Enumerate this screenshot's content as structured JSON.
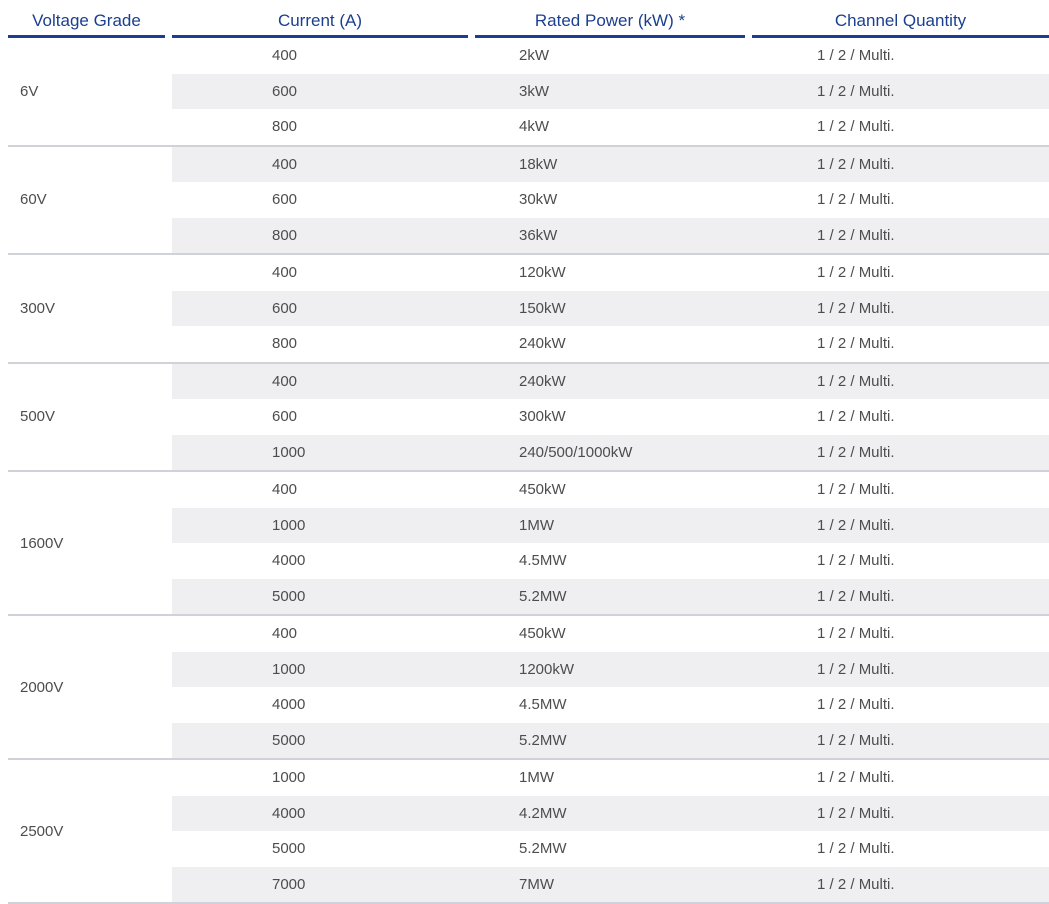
{
  "headers": [
    "Voltage Grade",
    "Current (A)",
    "Rated Power (kW) *",
    "Channel Quantity"
  ],
  "groups": [
    {
      "voltage": "6V",
      "rows": [
        {
          "current": "400",
          "power": "2kW",
          "channels": "1 / 2 / Multi."
        },
        {
          "current": "600",
          "power": "3kW",
          "channels": "1 / 2 / Multi."
        },
        {
          "current": "800",
          "power": "4kW",
          "channels": "1 / 2 / Multi."
        }
      ]
    },
    {
      "voltage": "60V",
      "rows": [
        {
          "current": "400",
          "power": "18kW",
          "channels": "1 / 2 / Multi."
        },
        {
          "current": "600",
          "power": "30kW",
          "channels": "1 / 2 / Multi."
        },
        {
          "current": "800",
          "power": "36kW",
          "channels": "1 / 2 / Multi."
        }
      ]
    },
    {
      "voltage": "300V",
      "rows": [
        {
          "current": "400",
          "power": "120kW",
          "channels": "1 / 2 / Multi."
        },
        {
          "current": "600",
          "power": "150kW",
          "channels": "1 / 2 / Multi."
        },
        {
          "current": "800",
          "power": "240kW",
          "channels": "1 / 2 / Multi."
        }
      ]
    },
    {
      "voltage": "500V",
      "rows": [
        {
          "current": "400",
          "power": "240kW",
          "channels": "1 / 2 / Multi."
        },
        {
          "current": "600",
          "power": "300kW",
          "channels": "1 / 2 / Multi."
        },
        {
          "current": "1000",
          "power": "240/500/1000kW",
          "channels": "1 / 2 / Multi."
        }
      ]
    },
    {
      "voltage": "1600V",
      "rows": [
        {
          "current": "400",
          "power": "450kW",
          "channels": "1 / 2 / Multi."
        },
        {
          "current": "1000",
          "power": "1MW",
          "channels": "1 / 2 / Multi."
        },
        {
          "current": "4000",
          "power": "4.5MW",
          "channels": "1 / 2 / Multi."
        },
        {
          "current": "5000",
          "power": "5.2MW",
          "channels": "1 / 2 / Multi."
        }
      ]
    },
    {
      "voltage": "2000V",
      "rows": [
        {
          "current": "400",
          "power": "450kW",
          "channels": "1 / 2 / Multi."
        },
        {
          "current": "1000",
          "power": "1200kW",
          "channels": "1 / 2 / Multi."
        },
        {
          "current": "4000",
          "power": "4.5MW",
          "channels": "1 / 2 / Multi."
        },
        {
          "current": "5000",
          "power": "5.2MW",
          "channels": "1 / 2 / Multi."
        }
      ]
    },
    {
      "voltage": "2500V",
      "rows": [
        {
          "current": "1000",
          "power": "1MW",
          "channels": "1 / 2 / Multi."
        },
        {
          "current": "4000",
          "power": "4.2MW",
          "channels": "1 / 2 / Multi."
        },
        {
          "current": "5000",
          "power": "5.2MW",
          "channels": "1 / 2 / Multi."
        },
        {
          "current": "7000",
          "power": "7MW",
          "channels": "1 / 2 / Multi."
        }
      ]
    }
  ]
}
